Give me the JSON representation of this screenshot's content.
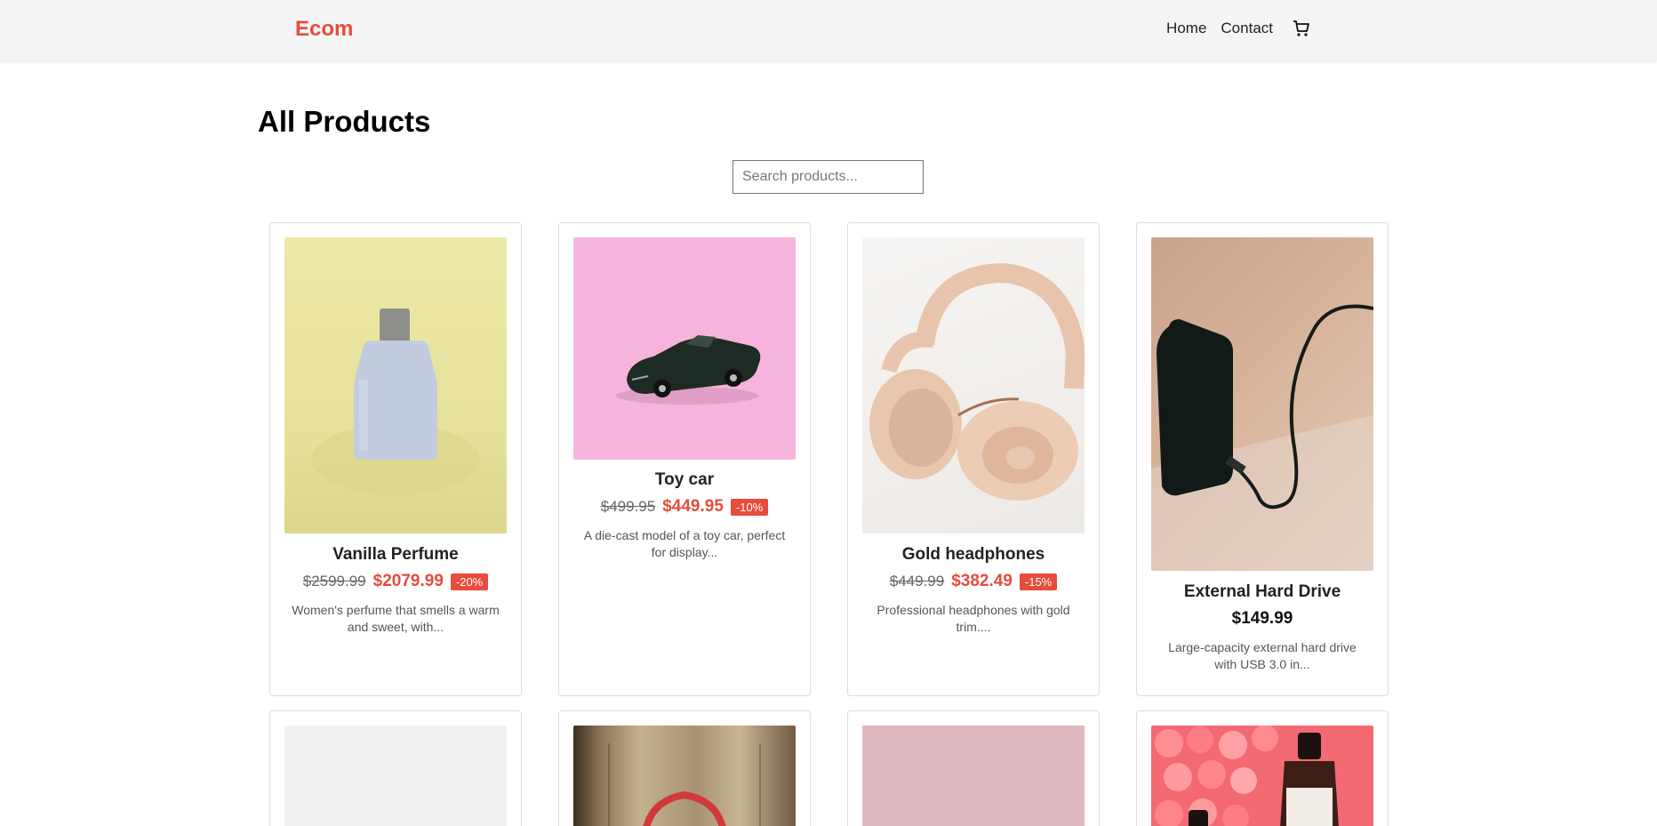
{
  "nav": {
    "brand": "Ecom",
    "links": [
      "Home",
      "Contact"
    ],
    "cart_icon": "cart-icon"
  },
  "page": {
    "title": "All Products",
    "search_placeholder": "Search products..."
  },
  "products": [
    {
      "name": "Vanilla Perfume",
      "old_price": "$2599.99",
      "price": "$2079.99",
      "discount": "-20%",
      "description": "Women's perfume that smells a warm and sweet, with..."
    },
    {
      "name": "Toy car",
      "old_price": "$499.95",
      "price": "$449.95",
      "discount": "-10%",
      "description": "A die-cast model of a toy car, perfect for display..."
    },
    {
      "name": "Gold headphones",
      "old_price": "$449.99",
      "price": "$382.49",
      "discount": "-15%",
      "description": "Professional headphones with gold trim...."
    },
    {
      "name": "External Hard Drive",
      "price": "$149.99",
      "description": "Large-capacity external hard drive with USB 3.0 in..."
    }
  ],
  "colors": {
    "accent": "#e74c3c",
    "navbar_bg": "#f5f5f5"
  }
}
